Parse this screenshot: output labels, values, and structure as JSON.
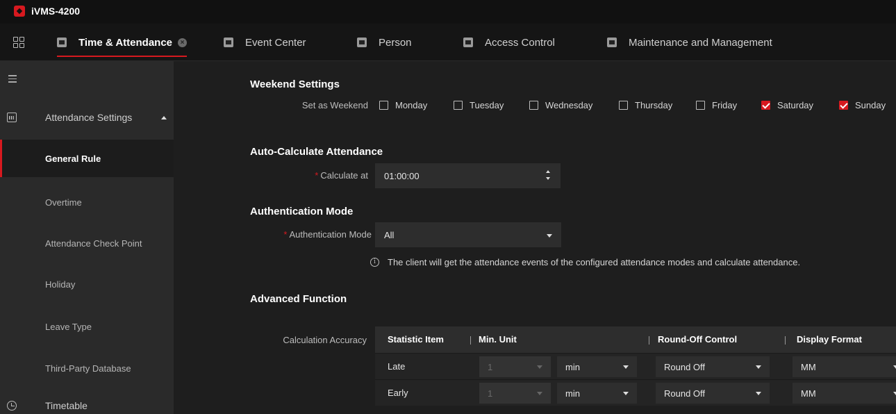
{
  "app": {
    "title": "iVMS-4200"
  },
  "tabs": [
    {
      "label": "Time & Attendance",
      "icon": "calendar-icon",
      "active": true
    },
    {
      "label": "Event Center",
      "icon": "alarm-icon"
    },
    {
      "label": "Person",
      "icon": "person-icon"
    },
    {
      "label": "Access Control",
      "icon": "door-icon"
    },
    {
      "label": "Maintenance and Management",
      "icon": "maintenance-icon"
    }
  ],
  "sidebar": {
    "group": {
      "label": "Attendance Settings",
      "icon": "calendar-icon"
    },
    "items": [
      {
        "label": "General Rule",
        "active": true
      },
      {
        "label": "Overtime"
      },
      {
        "label": "Attendance Check Point"
      },
      {
        "label": "Holiday"
      },
      {
        "label": "Leave Type"
      },
      {
        "label": "Third-Party Database"
      }
    ],
    "group2": {
      "label": "Timetable",
      "icon": "clock-icon"
    }
  },
  "weekend": {
    "title": "Weekend Settings",
    "label": "Set as Weekend",
    "days": [
      {
        "label": "Monday",
        "checked": false
      },
      {
        "label": "Tuesday",
        "checked": false
      },
      {
        "label": "Wednesday",
        "checked": false
      },
      {
        "label": "Thursday",
        "checked": false
      },
      {
        "label": "Friday",
        "checked": false
      },
      {
        "label": "Saturday",
        "checked": true
      },
      {
        "label": "Sunday",
        "checked": true
      }
    ]
  },
  "auto_calc": {
    "title": "Auto-Calculate Attendance",
    "label": "Calculate at",
    "required_mark": "*",
    "value": "01:00:00"
  },
  "auth_mode": {
    "title": "Authentication Mode",
    "label": "Authentication Mode",
    "required_mark": "*",
    "value": "All",
    "info": "The client will get the attendance events of the configured attendance modes and calculate attendance."
  },
  "advanced": {
    "title": "Advanced Function",
    "label": "Calculation Accuracy",
    "headers": {
      "item": "Statistic Item",
      "unit": "Min. Unit",
      "round": "Round-Off Control",
      "format": "Display Format"
    },
    "rows": [
      {
        "item": "Late",
        "min_unit": "1",
        "unit": "min",
        "round": "Round Off",
        "format": "MM"
      },
      {
        "item": "Early",
        "min_unit": "1",
        "unit": "min",
        "round": "Round Off",
        "format": "MM"
      }
    ]
  },
  "colors": {
    "accent": "#d7191f",
    "sidebar_bg": "#2a2a2a",
    "main_bg": "#1e1e1e"
  }
}
